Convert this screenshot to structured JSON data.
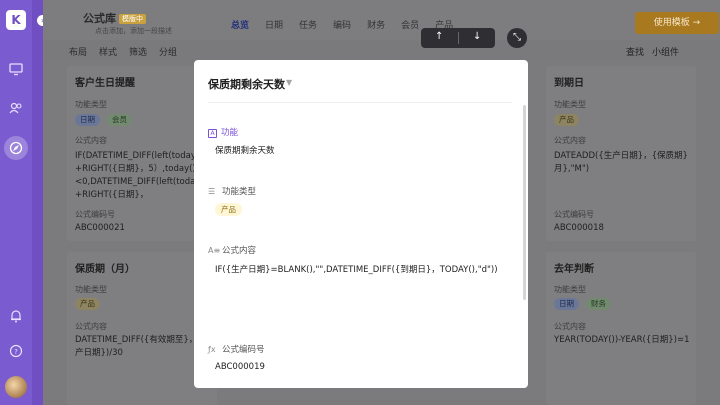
{
  "rail": {
    "logo": "K",
    "expander": "›"
  },
  "app": {
    "name": "公式库",
    "tag": "模版中",
    "desc": "点击添加，添加一段描述",
    "tabs": [
      "总览",
      "日期",
      "任务",
      "编码",
      "财务",
      "会员",
      "产品"
    ],
    "use_button": "使用模板 →",
    "toolbar_left": [
      "布局",
      "样式",
      "筛选",
      "分组"
    ],
    "toolbar_right": [
      "查找",
      "小组件"
    ]
  },
  "cards": [
    {
      "title": "客户生日提醒",
      "type_label": "功能类型",
      "chips": [
        "日期",
        "会员"
      ],
      "formula_label": "公式内容",
      "formula": "IF(DATETIME_DIFF(left(today()\n+RIGHT({日期}，5）,today(),\"d\"\n<0,DATETIME_DIFF(left(today(\n+RIGHT({日期}，",
      "code_label": "公式编码号",
      "code": "ABC000021"
    },
    {
      "title": "到期日",
      "type_label": "功能类型",
      "chips": [
        "产品"
      ],
      "formula_label": "公式内容",
      "formula": "DATEADD({生产日期}，{保质期}\n月},\"M\")",
      "code_label": "公式编码号",
      "code": "ABC000018"
    },
    {
      "title": "保质期（月）",
      "type_label": "功能类型",
      "chips": [
        "产品"
      ],
      "formula_label": "公式内容",
      "formula": "DATETIME_DIFF({有效期至}，{\n产日期})/30",
      "code_label": "公式编码号",
      "code": ""
    },
    {
      "title": "去年判断",
      "type_label": "功能类型",
      "chips": [
        "日期",
        "财务"
      ],
      "formula_label": "公式内容",
      "formula": "YEAR(TODAY())-YEAR({日期})=1",
      "code_label": "公式编码号",
      "code": ""
    }
  ],
  "modal": {
    "title": "保质期剩余天数",
    "field1_label": "功能",
    "field1_value": "保质期剩余天数",
    "field2_label": "功能类型",
    "field2_chip": "产品",
    "field3_label": "公式内容",
    "field3_value": "IF({生产日期}=BLANK(),\"\",DATETIME_DIFF({到期日}，TODAY(),\"d\"))",
    "field4_label": "公式编码号",
    "field4_value": "ABC000019"
  },
  "icons": {
    "up": "↑",
    "down": "↓",
    "collapse": "⤡",
    "caret": "▼"
  }
}
